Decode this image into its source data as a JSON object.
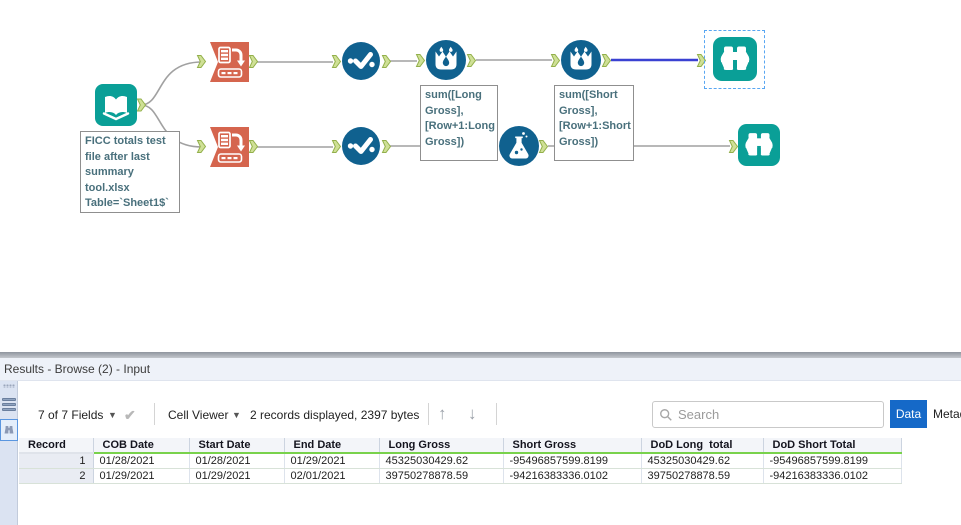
{
  "canvas": {
    "annotations": {
      "input": "FICC totals test\nfile after last\nsummary\ntool.xlsx\nTable=`Sheet1$`",
      "formula_long": "sum([Long\nGross],\n[Row+1:Long\nGross])",
      "formula_short": "sum([Short\nGross],\n[Row+1:Short\nGross])"
    },
    "icons": {
      "input_tool": "book-icon",
      "transform_tool": "table-arrow-icon",
      "select_tool": "check-dots-icon",
      "multi_row_formula_tool": "bucket-droplet-icon",
      "formula_tool": "flask-icon",
      "browse_tool": "binoculars-icon"
    },
    "colors": {
      "tool_teal": "#0a9f97",
      "tool_blue": "#10618f",
      "tool_orange": "#d5654e",
      "wire": "#a1a1a1",
      "wire_selected": "#3a41d2",
      "anchor_fill": "#cfe096"
    }
  },
  "results": {
    "title": "Results - Browse (2) - Input",
    "toolbar": {
      "fields": "7 of 7 Fields",
      "check": "✔",
      "cell_viewer": "Cell Viewer",
      "records": "2 records displayed, 2397 bytes",
      "up_arrow": "↑",
      "down_arrow": "↓",
      "search_placeholder": "Search",
      "data_tab": "Data",
      "metadata_tab": "Metadata"
    },
    "table": {
      "columns": [
        "Record",
        "COB Date",
        "Start Date",
        "End Date",
        "Long Gross",
        "Short Gross",
        "DoD Long  total",
        "DoD Short Total"
      ],
      "rows": [
        [
          "1",
          "01/28/2021",
          "01/28/2021",
          "01/29/2021",
          "45325030429.62",
          "-95496857599.8199",
          "45325030429.62",
          "-95496857599.8199"
        ],
        [
          "2",
          "01/29/2021",
          "01/29/2021",
          "02/01/2021",
          "39750278878.59",
          "-94216383336.0102",
          "39750278878.59",
          "-94216383336.0102"
        ]
      ]
    }
  }
}
